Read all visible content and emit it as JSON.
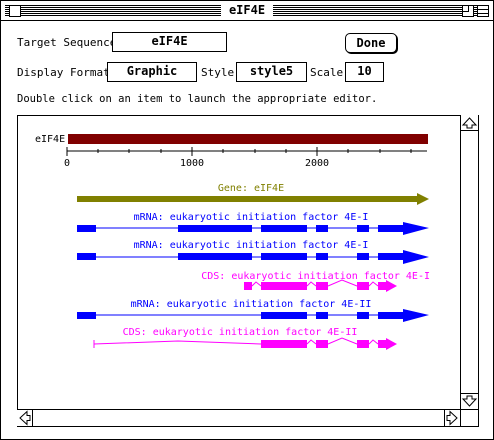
{
  "window": {
    "title": "eIF4E"
  },
  "form": {
    "target_label": "Target Sequence",
    "target_value": "eIF4E",
    "done_label": "Done",
    "display_label": "Display Format",
    "display_value": "Graphic",
    "style_label": "Style",
    "style_value": "style5",
    "scale_label": "Scale",
    "scale_value": "10",
    "instructions": "Double click on an item to launch the appropriate editor."
  },
  "map": {
    "sequence_name": "eIF4E",
    "ruler_ticks": [
      "0",
      "1000",
      "2000"
    ],
    "colors": {
      "sequence": "#800000",
      "gene": "#808000",
      "mrna": "#0000ff",
      "cds": "#ff00ff"
    },
    "features": [
      {
        "type": "gene",
        "label": "Gene: eIF4E"
      },
      {
        "type": "mrna",
        "label": "mRNA: eukaryotic initiation factor 4E-I"
      },
      {
        "type": "mrna",
        "label": "mRNA: eukaryotic initiation factor 4E-I"
      },
      {
        "type": "cds",
        "label": "CDS: eukaryotic initiation factor 4E-I"
      },
      {
        "type": "mrna",
        "label": "mRNA: eukaryotic initiation factor 4E-II"
      },
      {
        "type": "cds",
        "label": "CDS: eukaryotic initiation factor 4E-II"
      }
    ]
  },
  "icons": {
    "close": "close-box-icon",
    "zoom": "zoom-box-icon",
    "collapse": "collapse-box-icon",
    "up": "scroll-up-arrow-icon",
    "down": "scroll-down-arrow-icon",
    "left": "scroll-left-arrow-icon",
    "right": "scroll-right-arrow-icon"
  }
}
